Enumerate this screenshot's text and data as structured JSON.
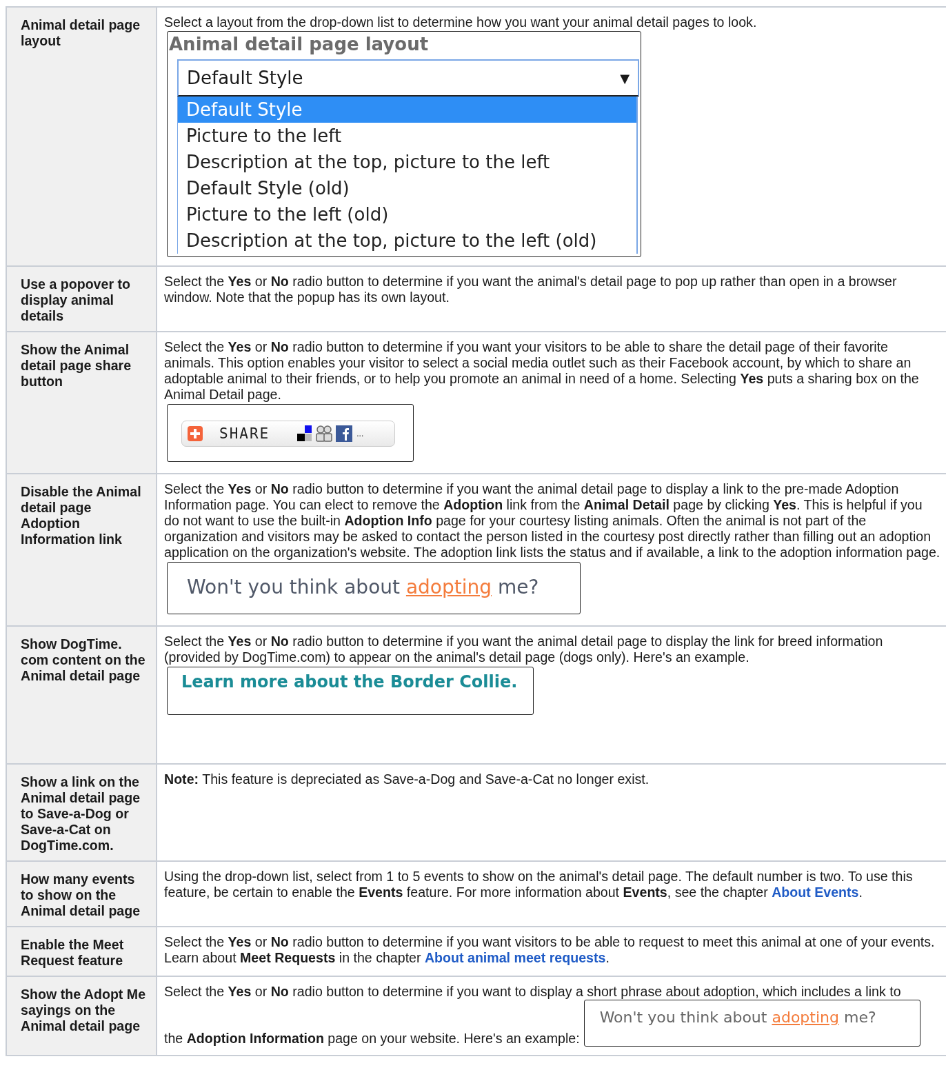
{
  "rows": [
    {
      "label": "Animal detail page layout",
      "content": [
        {
          "kind": "paragraph",
          "segments": [
            {
              "kind": "text",
              "text": "Select a layout from the drop-down list to determine how you want your animal detail pages to look."
            }
          ]
        },
        {
          "kind": "dropdown",
          "title": "Animal detail page layout",
          "value": "Default Style",
          "caret": "▼",
          "options": [
            {
              "label": "Default Style",
              "selected": true
            },
            {
              "label": "Picture to the left",
              "selected": false
            },
            {
              "label": "Description at the top, picture to the left",
              "selected": false
            },
            {
              "label": "Default Style (old)",
              "selected": false
            },
            {
              "label": "Picture to the left (old)",
              "selected": false
            },
            {
              "label": "Description at the top, picture to the left (old)",
              "selected": false
            }
          ]
        }
      ]
    },
    {
      "label": "Use a popover to display animal details",
      "content": [
        {
          "kind": "paragraph",
          "segments": [
            {
              "kind": "text",
              "text": "Select the **Yes** or **No** radio button to determine if you want the animal's detail page to pop up rather than open in a browser window. Note that the popup has its own layout."
            }
          ]
        }
      ]
    },
    {
      "label": "Show the Animal detail page share button",
      "content": [
        {
          "kind": "paragraph",
          "segments": [
            {
              "kind": "text",
              "text": "Select the **Yes** or **No** radio button to determine if you want your visitors to be able to share the detail page of their favorite animals. This option enables your visitor to select a social media outlet such as their Facebook account, by which to share an adoptable animal to their friends, or to help you promote an animal in need of a home. Selecting **Yes** puts a sharing box on the Animal Detail page."
            }
          ]
        },
        {
          "kind": "share",
          "label": "SHARE",
          "more": "..."
        }
      ]
    },
    {
      "label": "Disable the Animal detail page Adoption Information link",
      "content": [
        {
          "kind": "paragraph",
          "segments": [
            {
              "kind": "text",
              "text": "Select the **Yes** or **No** radio button to determine if you want the animal detail page to display a link to the pre-made Adoption Information page. You can elect to remove the **Adoption** link from the **Animal Detail** page by clicking **Yes**. This is helpful if you do not want to use the built-in **Adoption Info** page for your courtesy listing animals. Often the animal is not part of the organization and visitors may be asked to contact the person listed in the courtesy post directly rather than filling out an adoption application on the organization's website. The adoption link lists the status and if available, a link to the adoption information page."
            }
          ]
        },
        {
          "kind": "phrase",
          "before": "Won't you think about",
          "link": "adopting",
          "after": "me?"
        }
      ]
    },
    {
      "label": "Show DogTime. com content on the Animal detail page",
      "content": [
        {
          "kind": "paragraph",
          "segments": [
            {
              "kind": "text",
              "text": "Select the **Yes** or **No** radio button to determine if you want the animal detail page to display the link for breed information (provided by DogTime.com) to appear on the animal's detail page (dogs only). Here's an example."
            }
          ]
        },
        {
          "kind": "breed",
          "text": "Learn more about the Border Collie."
        }
      ]
    },
    {
      "label": "Show a link on the Animal detail page to Save-a-Dog or Save-a-Cat on DogTime.com.",
      "content": [
        {
          "kind": "paragraph",
          "segments": [
            {
              "kind": "text",
              "text": "**Note:** This feature is depreciated as Save-a-Dog and Save-a-Cat no longer exist."
            }
          ]
        }
      ]
    },
    {
      "label": "How many events to show on the Animal detail page",
      "content": [
        {
          "kind": "paragraph",
          "segments": [
            {
              "kind": "text",
              "text": "Using the drop-down list, select from 1 to 5 events to show on the animal's detail page. The default number is two. To use this feature, be certain to enable the **Events** feature. For more information about **Events**, see the chapter "
            },
            {
              "kind": "link",
              "text": "About Events"
            },
            {
              "kind": "text",
              "text": "."
            }
          ]
        }
      ]
    },
    {
      "label": "Enable the Meet Request feature",
      "content": [
        {
          "kind": "paragraph",
          "segments": [
            {
              "kind": "text",
              "text": "Select the **Yes** or **No** radio button to determine if you want visitors to be able to request to meet this animal at one of your events. Learn about **Meet Requests** in the chapter "
            },
            {
              "kind": "link",
              "text": "About animal meet requests"
            },
            {
              "kind": "text",
              "text": "."
            }
          ]
        }
      ]
    },
    {
      "label": "Show the Adopt Me sayings on the Animal detail page",
      "content": [
        {
          "kind": "line-paragraph",
          "segments": [
            {
              "kind": "text",
              "text": "Select the **Yes** or **No** radio button to determine if you want to display a short phrase about adoption, which includes a link to"
            }
          ]
        },
        {
          "kind": "example-row",
          "segments": [
            {
              "kind": "text",
              "text": "the **Adoption Information** page on your website. Here's an example:"
            }
          ],
          "before": "Won't you think about",
          "link": "adopting",
          "after": "me?"
        }
      ]
    }
  ]
}
